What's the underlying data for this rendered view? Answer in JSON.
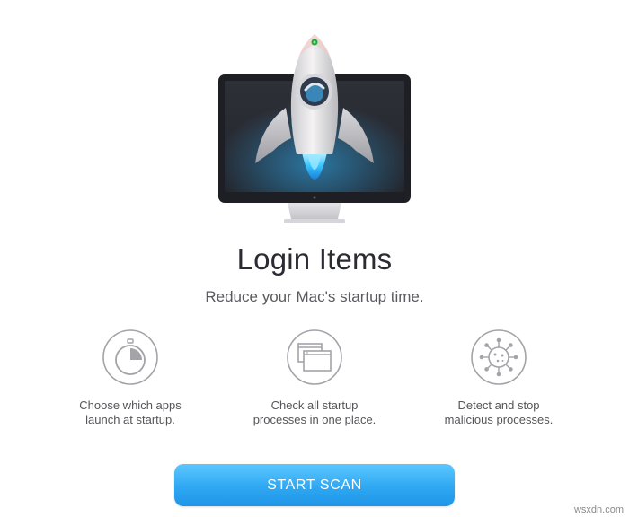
{
  "header": {
    "title": "Login Items",
    "subtitle": "Reduce your Mac's startup time."
  },
  "hero": {
    "icon": "rocket-monitor-icon"
  },
  "features": [
    {
      "icon": "stopwatch-icon",
      "line1": "Choose which apps",
      "line2": "launch at startup."
    },
    {
      "icon": "windows-stack-icon",
      "line1": "Check all startup",
      "line2": "processes in one place."
    },
    {
      "icon": "virus-icon",
      "line1": "Detect and stop",
      "line2": "malicious processes."
    }
  ],
  "actions": {
    "start_scan_label": "START SCAN"
  },
  "watermark": "wsxdn.com",
  "colors": {
    "accent": "#2fa8f2",
    "icon_stroke": "#a3a3a8",
    "text": "#2b2b33"
  }
}
